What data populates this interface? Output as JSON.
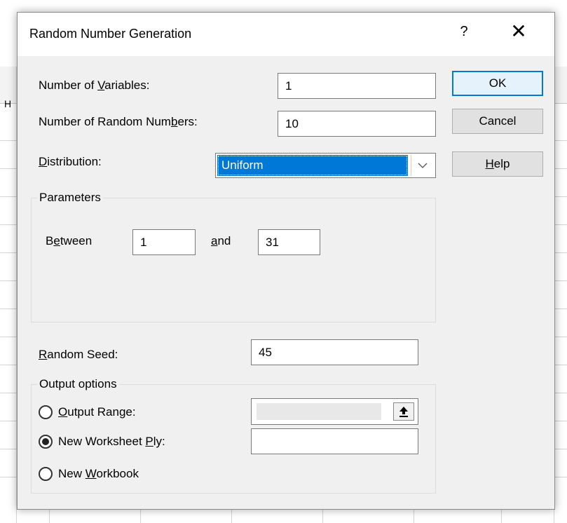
{
  "dialog": {
    "title": "Random Number Generation",
    "help_symbol": "?",
    "close_symbol": "✕"
  },
  "sheet": {
    "col_header_partial": "H"
  },
  "fields": {
    "num_variables": {
      "label_pre": "Number of ",
      "label_u": "V",
      "label_post": "ariables:",
      "value": "1"
    },
    "num_random": {
      "label_pre": "Number of Random Num",
      "label_u": "b",
      "label_post": "ers:",
      "value": "10"
    },
    "distribution": {
      "label_pre": "",
      "label_u": "D",
      "label_post": "istribution:",
      "value": "Uniform"
    }
  },
  "parameters": {
    "group_label": "Parameters",
    "between_pre": "B",
    "between_u": "e",
    "between_post": "tween",
    "between_value": "1",
    "and_u": "a",
    "and_post": "nd",
    "and_value": "31"
  },
  "seed": {
    "label_pre": "",
    "label_u": "R",
    "label_post": "andom Seed:",
    "value": "45"
  },
  "output": {
    "group_label": "Output options",
    "range": {
      "label_pre": "",
      "label_u": "O",
      "label_post": "utput Range:",
      "checked": false,
      "value": ""
    },
    "worksheet": {
      "label_pre": "New Worksheet ",
      "label_u": "P",
      "label_post": "ly:",
      "checked": true,
      "value": ""
    },
    "workbook": {
      "label_pre": "New ",
      "label_u": "W",
      "label_post": "orkbook",
      "checked": false
    }
  },
  "buttons": {
    "ok": "OK",
    "cancel": "Cancel",
    "help_u": "H",
    "help_post": "elp"
  },
  "icons": {
    "collapse": "arrow-up-collapse-icon",
    "dropdown": "chevron-down-icon"
  },
  "colors": {
    "accent": "#0078d7",
    "dialog_bg": "#f0f0f0"
  }
}
